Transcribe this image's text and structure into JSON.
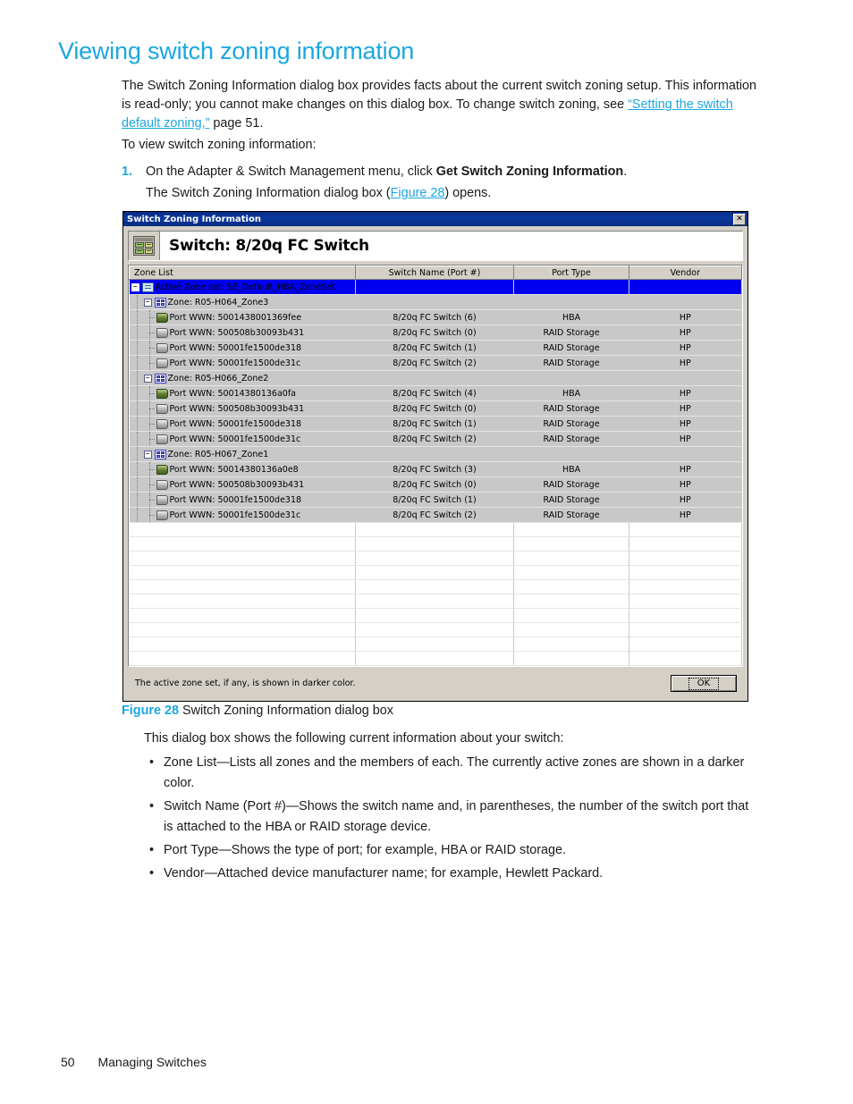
{
  "heading": "Viewing switch zoning information",
  "intro": {
    "part1": "The Switch Zoning Information dialog box provides facts about the current switch zoning setup. This information is read-only; you cannot make changes on this dialog box. To change switch zoning, see ",
    "link": "“Setting the switch default zoning,”",
    "part2": " page 51."
  },
  "to_view": "To view switch zoning information:",
  "step": {
    "number": "1.",
    "text_before": "On the Adapter & Switch Management menu, click ",
    "bold": "Get Switch Zoning Information",
    "text_after": ".",
    "subtext_before": "The Switch Zoning Information dialog box (",
    "subtext_link": "Figure 28",
    "subtext_after": ") opens."
  },
  "dialog": {
    "title": "Switch Zoning Information",
    "close_label": "✕",
    "switch_header": "Switch: 8/20q FC Switch",
    "columns": [
      "Zone List",
      "Switch Name (Port #)",
      "Port Type",
      "Vendor"
    ],
    "rows": [
      {
        "level": 0,
        "icon": "zoneset-icon",
        "expander": "−",
        "label": "Active Zone set: SE_Default_HBA_ZoneSet",
        "switch_name": "",
        "port_type": "",
        "vendor": "",
        "style": "selected"
      },
      {
        "level": 1,
        "icon": "zone-icon",
        "expander": "−",
        "label": "Zone: R05-H064_Zone3",
        "switch_name": "",
        "port_type": "",
        "vendor": "",
        "style": "shaded"
      },
      {
        "level": 2,
        "icon": "port-hba-icon",
        "expander": "",
        "label": "Port WWN: 5001438001369fee",
        "switch_name": "8/20q FC Switch (6)",
        "port_type": "HBA",
        "vendor": "HP",
        "style": "shaded"
      },
      {
        "level": 2,
        "icon": "port-icon",
        "expander": "",
        "label": "Port WWN: 500508b30093b431",
        "switch_name": "8/20q FC Switch (0)",
        "port_type": "RAID Storage",
        "vendor": "HP",
        "style": "shaded"
      },
      {
        "level": 2,
        "icon": "port-icon",
        "expander": "",
        "label": "Port WWN: 50001fe1500de318",
        "switch_name": "8/20q FC Switch (1)",
        "port_type": "RAID Storage",
        "vendor": "HP",
        "style": "shaded"
      },
      {
        "level": 2,
        "icon": "port-icon",
        "expander": "",
        "label": "Port WWN: 50001fe1500de31c",
        "switch_name": "8/20q FC Switch (2)",
        "port_type": "RAID Storage",
        "vendor": "HP",
        "style": "shaded"
      },
      {
        "level": 1,
        "icon": "zone-icon",
        "expander": "−",
        "label": "Zone: R05-H066_Zone2",
        "switch_name": "",
        "port_type": "",
        "vendor": "",
        "style": "shaded"
      },
      {
        "level": 2,
        "icon": "port-hba-icon",
        "expander": "",
        "label": "Port WWN: 50014380136a0fa",
        "switch_name": "8/20q FC Switch (4)",
        "port_type": "HBA",
        "vendor": "HP",
        "style": "shaded"
      },
      {
        "level": 2,
        "icon": "port-icon",
        "expander": "",
        "label": "Port WWN: 500508b30093b431",
        "switch_name": "8/20q FC Switch (0)",
        "port_type": "RAID Storage",
        "vendor": "HP",
        "style": "shaded"
      },
      {
        "level": 2,
        "icon": "port-icon",
        "expander": "",
        "label": "Port WWN: 50001fe1500de318",
        "switch_name": "8/20q FC Switch (1)",
        "port_type": "RAID Storage",
        "vendor": "HP",
        "style": "shaded"
      },
      {
        "level": 2,
        "icon": "port-icon",
        "expander": "",
        "label": "Port WWN: 50001fe1500de31c",
        "switch_name": "8/20q FC Switch (2)",
        "port_type": "RAID Storage",
        "vendor": "HP",
        "style": "shaded"
      },
      {
        "level": 1,
        "icon": "zone-icon",
        "expander": "−",
        "label": "Zone: R05-H067_Zone1",
        "switch_name": "",
        "port_type": "",
        "vendor": "",
        "style": "shaded"
      },
      {
        "level": 2,
        "icon": "port-hba-icon",
        "expander": "",
        "label": "Port WWN: 50014380136a0e8",
        "switch_name": "8/20q FC Switch (3)",
        "port_type": "HBA",
        "vendor": "HP",
        "style": "shaded"
      },
      {
        "level": 2,
        "icon": "port-icon",
        "expander": "",
        "label": "Port WWN: 500508b30093b431",
        "switch_name": "8/20q FC Switch (0)",
        "port_type": "RAID Storage",
        "vendor": "HP",
        "style": "shaded"
      },
      {
        "level": 2,
        "icon": "port-icon",
        "expander": "",
        "label": "Port WWN: 50001fe1500de318",
        "switch_name": "8/20q FC Switch (1)",
        "port_type": "RAID Storage",
        "vendor": "HP",
        "style": "shaded"
      },
      {
        "level": 2,
        "icon": "port-icon",
        "expander": "",
        "label": "Port WWN: 50001fe1500de31c",
        "switch_name": "8/20q FC Switch (2)",
        "port_type": "RAID Storage",
        "vendor": "HP",
        "style": "shaded"
      }
    ],
    "empty_row_count": 10,
    "footer_note": "The active zone set, if any, is shown in darker color.",
    "ok_label": "OK"
  },
  "figure": {
    "number": "Figure 28",
    "caption": "Switch Zoning Information dialog box"
  },
  "after_figure": {
    "lead": "This dialog box shows the following current information about your switch:",
    "bullets": [
      "Zone List—Lists all zones and the members of each. The currently active zones are shown in a darker color.",
      "Switch Name (Port #)—Shows the switch name and, in parentheses, the number of the switch port that is attached to the HBA or RAID storage device.",
      "Port Type—Shows the type of port; for example, HBA or RAID storage.",
      "Vendor—Attached device manufacturer name; for example, Hewlett Packard."
    ]
  },
  "page_footer": {
    "page_number": "50",
    "section": "Managing Switches"
  },
  "colors": {
    "accent": "#1aa7e0",
    "selection": "#0000ee",
    "dialog_face": "#d4d0c8",
    "titlebar": "#0a2a80"
  }
}
